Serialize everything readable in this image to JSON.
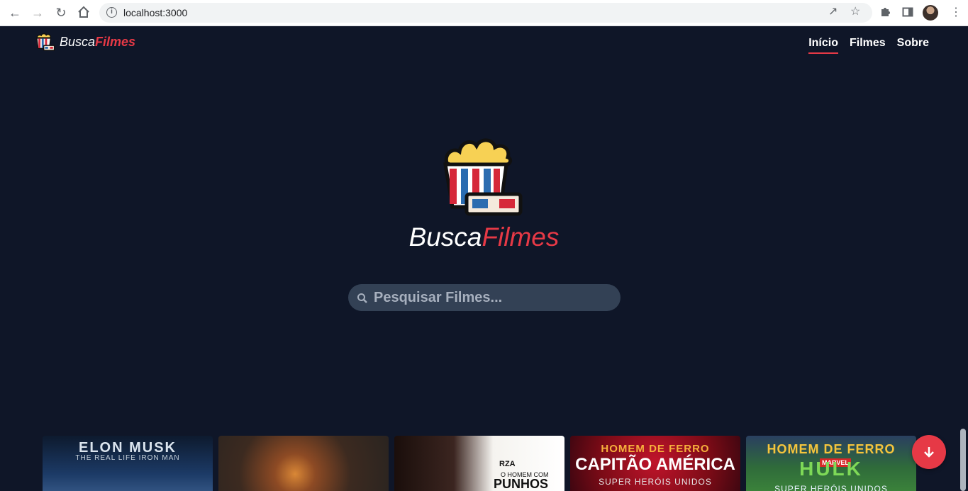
{
  "browser": {
    "url": "localhost:3000",
    "back_icon": "arrow-left-icon",
    "forward_icon": "arrow-right-icon",
    "reload_icon": "reload-icon",
    "home_icon": "home-icon",
    "share_icon": "share-icon",
    "star_icon": "star-icon",
    "extensions_icon": "puzzle-icon",
    "sidepanel_icon": "side-panel-icon",
    "menu_icon": "more-vertical-icon"
  },
  "header": {
    "brand_part1": "Busca",
    "brand_part2": "Filmes",
    "nav": [
      {
        "label": "Início",
        "active": true
      },
      {
        "label": "Filmes",
        "active": false
      },
      {
        "label": "Sobre",
        "active": false
      }
    ]
  },
  "hero": {
    "title_part1": "Busca",
    "title_part2": "Filmes"
  },
  "search": {
    "placeholder": "Pesquisar Filmes...",
    "value": ""
  },
  "posters": [
    {
      "title": "ELON MUSK",
      "subtitle": "THE REAL LIFE IRON MAN"
    },
    {
      "title": ""
    },
    {
      "tag": "RZA",
      "line1": "O HOMEM",
      "line2": "COM",
      "line3": "PUNHOS"
    },
    {
      "title": "HOMEM DE FERRO",
      "line2": "CAPITÃO AMÉRICA",
      "line3": "SUPER HERÓIS UNIDOS"
    },
    {
      "title": "HOMEM DE FERRO",
      "logo": "MARVEL",
      "line2": "HULK",
      "line3": "SUPER HERÓIS UNIDOS"
    }
  ],
  "colors": {
    "background": "#0f1628",
    "accent": "#e63946",
    "search_bg": "#334155"
  }
}
